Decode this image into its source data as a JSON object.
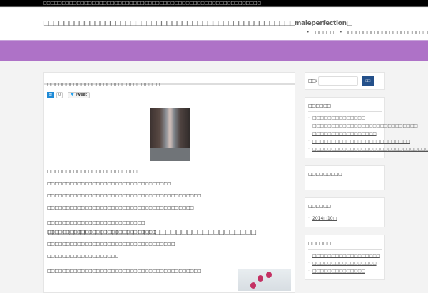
{
  "topbar": {
    "text": "□□□□□□□□□□□□□□□□□□□□□□□□□□□□□□□□□□□□□□□□□□□□□□□□□□□□□□□□□□"
  },
  "header": {
    "title_pre": "□□□□□□□□□□□□□□□□□□□□□□□□□□□□□□□□□□□□□□□□□□□□□□□□□",
    "title_brand": "maleperfection",
    "title_post": "□",
    "nav": [
      "□□□□□□",
      "□□□□□□□□□□□□□□□□□□□□□□□□□"
    ]
  },
  "post": {
    "title": "□□□□□□□□□□□□□□□□□□□□□□□□□□□□□□",
    "share": {
      "hatena": "B!",
      "count": "0",
      "tweet": "Tweet"
    },
    "lines": [
      "□□□□□□□□□□□□□□□□□□□□□□□□",
      "□□□□□□□□□□□□□□□□□□□□□□□□□□□□□□□□□",
      "□□□□□□□□□□□□□□□□□□□□□□□□□□□□□□□□□□□□□□□□□",
      "□□□□□□□□□□□□□□□□□□□□□□□□□□□□□□□□□□□□□□□"
    ],
    "mixed_line": "□□□□□□□□□□□□□□□□□□□□□□□□□□",
    "link_line": "□□□□□□□□□□□□□□□□□□□□□□□□□□□□□□□□□□□□□□□",
    "lines2": [
      "□□□□□□□□□□□□□□□□□□□□□□□□□□□□□",
      "□□□□□□□□□□□□□□□□□□□□□□□□□□□□□□□□□□",
      "□□□□□□□□□□□□□□□□□□□"
    ],
    "last_line": "□□□□□□□□□□□□□□□□□□□□□□□□□□□□□□□□□□□□□□□□□"
  },
  "sidebar": {
    "search_label": "□□:",
    "search_value": "",
    "search_button": "□□",
    "recent_title": "□□□□□□",
    "recent": [
      "□□□□□□□□□□□□□□",
      "□□□□□□□□□□□□□□□□□□□□□□□□□□□□",
      "□□□□□□□□□□□□□□□□□",
      "□□□□□□□□□□□□□□□□□□□□□□□□□□",
      "□□□□□□□□□□□□□□□□□□□□□□□□□□□□□□□□□"
    ],
    "comments_title": "□□□□□□□□□",
    "archive_title": "□□□□□□",
    "archives": [
      "2014□10□"
    ],
    "categories_title": "□□□□□□",
    "categories": [
      "□□□□□□□□□□□□□□□□□□",
      "□□□□□□□□□□□□□□□□□",
      "□□□□□□□□□□□□□□"
    ]
  }
}
